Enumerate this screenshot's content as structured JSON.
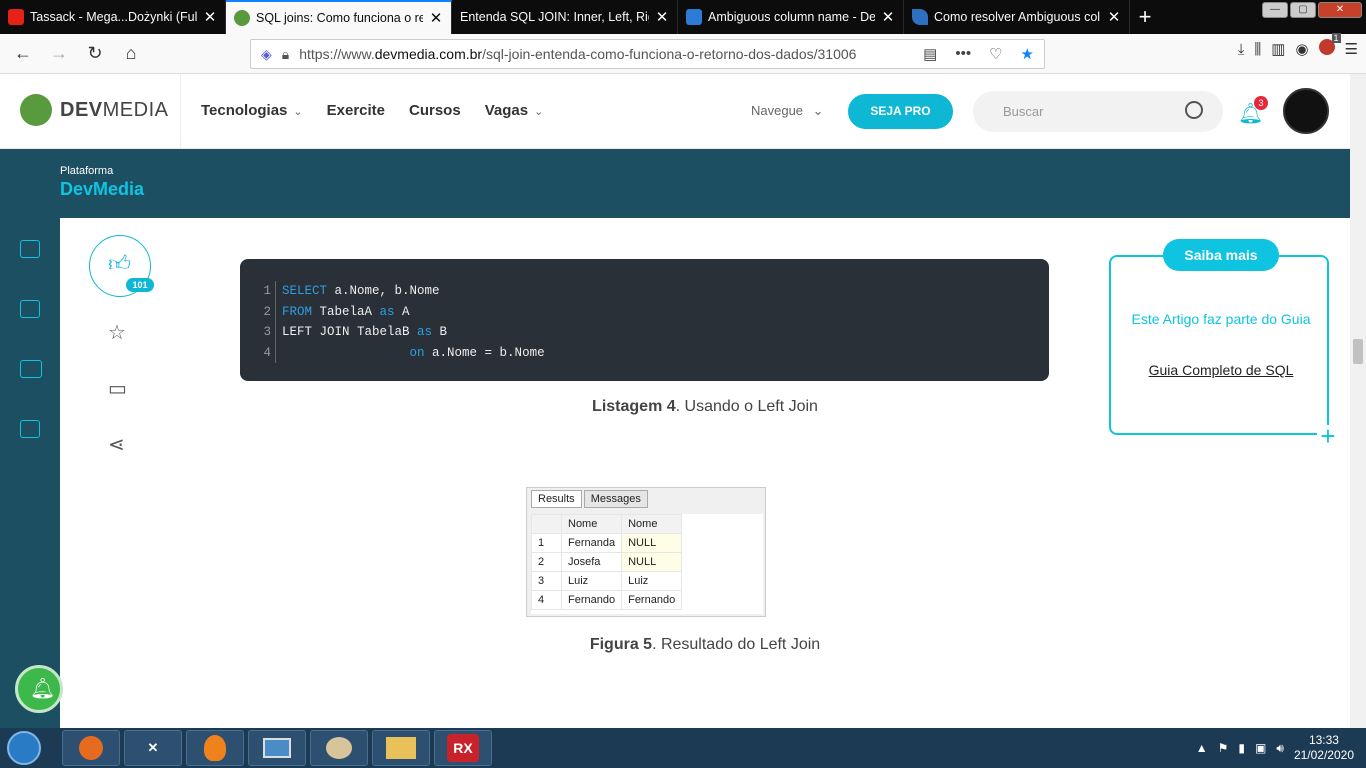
{
  "browser": {
    "tabs": [
      {
        "title": "Tassack - Mega...Dożynki (Full",
        "favicon": "youtube-icon"
      },
      {
        "title": "SQL joins: Como funciona o ret",
        "favicon": "devmedia-icon"
      },
      {
        "title": "Entenda SQL JOIN: Inner, Left, Righ",
        "favicon": "page-icon"
      },
      {
        "title": "Ambiguous column name - De",
        "favicon": "grid-icon"
      },
      {
        "title": "Como resolver Ambiguous col",
        "favicon": "feather-icon"
      }
    ],
    "url_prefix": "https://www.",
    "url_host": "devmedia.com.br",
    "url_path": "/sql-join-entenda-como-funciona-o-retorno-dos-dados/31006",
    "addon_badge": "1"
  },
  "site": {
    "logo_bold": "DEV",
    "logo_light": "MEDIA",
    "menu": [
      {
        "label": "Tecnologias",
        "dropdown": true
      },
      {
        "label": "Exercite",
        "dropdown": false
      },
      {
        "label": "Cursos",
        "dropdown": false
      },
      {
        "label": "Vagas",
        "dropdown": true
      }
    ],
    "navegue": "Navegue",
    "seja_pro": "SEJA PRO",
    "search_placeholder": "Buscar",
    "notif_count": "3",
    "platform_label": "Plataforma",
    "platform_name": "DevMedia"
  },
  "article": {
    "like_count": "101",
    "code_lines": [
      [
        "SELECT",
        " a.Nome, b.Nome"
      ],
      [
        "FROM",
        " TabelaA ",
        "as",
        " A"
      ],
      [
        "",
        "LEFT JOIN TabelaB ",
        "as",
        " B"
      ],
      [
        "",
        "                 ",
        "on",
        " a.Nome = b.Nome"
      ]
    ],
    "listing_caption_bold": "Listagem 4",
    "listing_caption": ". Usando o Left Join",
    "figure_tabs": [
      "Results",
      "Messages"
    ],
    "figure_headers": [
      "Nome",
      "Nome"
    ],
    "figure_rows": [
      [
        "1",
        "Fernanda",
        "NULL"
      ],
      [
        "2",
        "Josefa",
        "NULL"
      ],
      [
        "3",
        "Luiz",
        "Luiz"
      ],
      [
        "4",
        "Fernando",
        "Fernando"
      ]
    ],
    "figure_caption_bold": "Figura 5",
    "figure_caption": ". Resultado do Left Join"
  },
  "saiba": {
    "title": "Saiba mais",
    "text": "Este Artigo faz parte do Guia",
    "link": "Guia Completo de SQL"
  },
  "taskbar": {
    "time": "13:33",
    "date": "21/02/2020"
  },
  "colors": {
    "accent": "#0eb7d3",
    "band": "#1d4f63",
    "code_bg": "#2a3038"
  }
}
